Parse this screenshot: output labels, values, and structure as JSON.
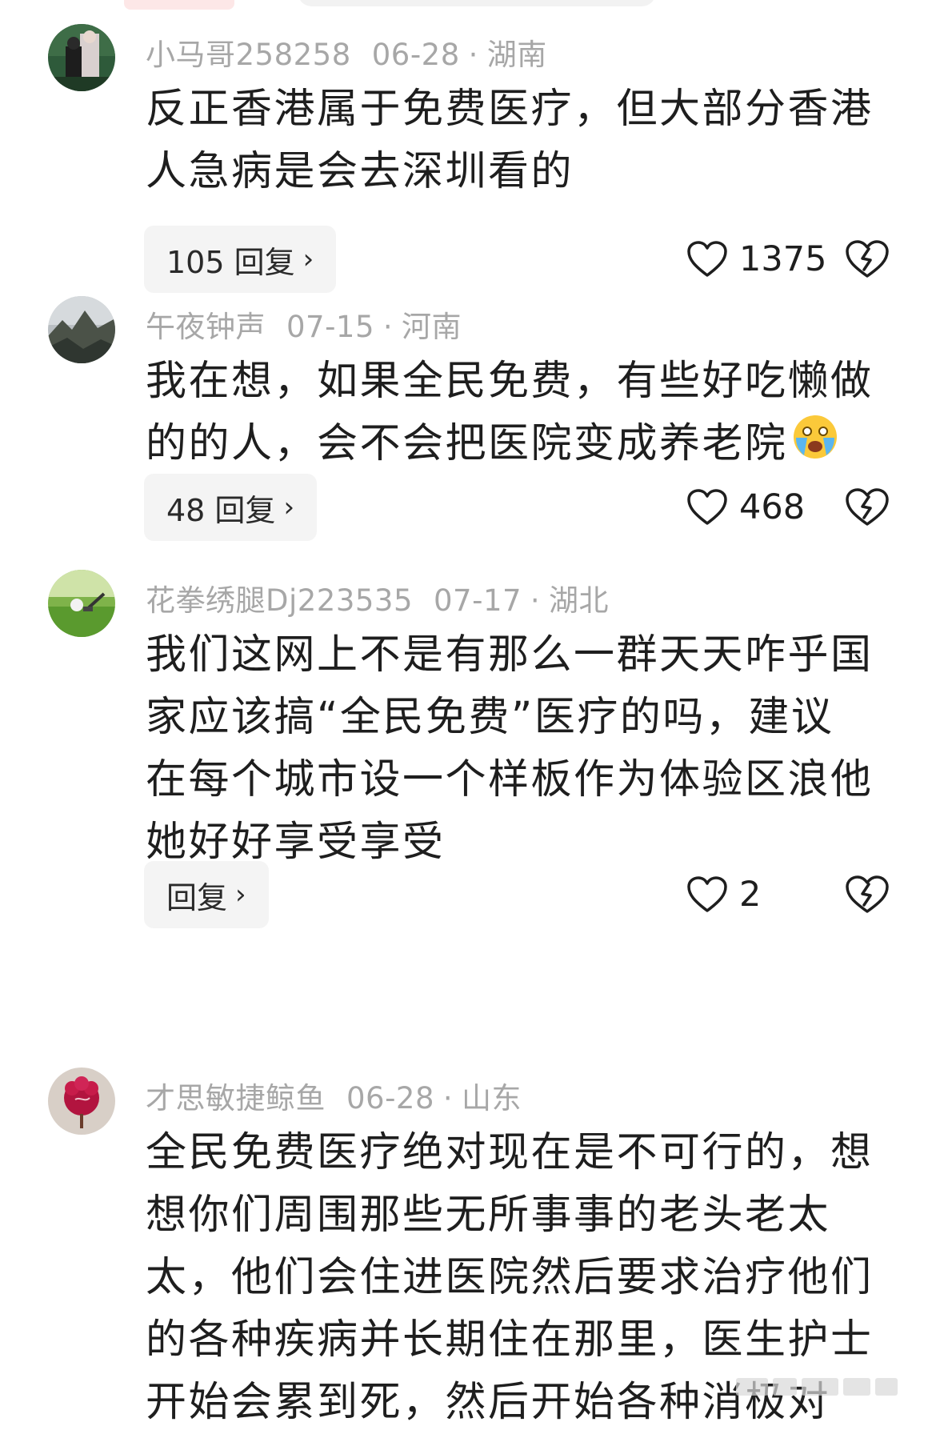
{
  "comments": [
    {
      "username": "小马哥258258",
      "date": "06-28",
      "separator": "·",
      "location": "湖南",
      "text_lines": [
        "反正香港属于免费医疗，但大部分香港",
        "人急病是会去深圳看的"
      ],
      "reply_label": "105 回复",
      "likes": "1375"
    },
    {
      "username": "午夜钟声",
      "date": "07-15",
      "separator": "·",
      "location": "河南",
      "text_lines": [
        "我在想，如果全民免费，有些好吃懒做",
        "的的人，会不会把医院变成养老院"
      ],
      "reply_label": "48 回复",
      "likes": "468"
    },
    {
      "username": "花拳绣腿Dj223535",
      "date": "07-17",
      "separator": "·",
      "location": "湖北",
      "text_lines": [
        "我们这网上不是有那么一群天天咋乎国",
        "家应该搞“全民免费”医疗的吗，建议",
        "在每个城市设一个样板作为体验区浪他",
        "她好好享受享受"
      ],
      "reply_label": "回复",
      "likes": "2"
    },
    {
      "username": "才思敏捷鲸鱼",
      "date": "06-28",
      "separator": "·",
      "location": "山东",
      "text_lines": [
        "全民免费医疗绝对现在是不可行的，想",
        "想你们周围那些无所事事的老头老太",
        "太，他们会住进医院然后要求治疗他们",
        "的各种疾病并长期住在那里，医生护士",
        "开始会累到死，然后开始各种消极对"
      ]
    }
  ],
  "chevron": "›",
  "icons": {
    "like": "heart-outline-icon",
    "dislike": "broken-heart-icon",
    "emoji": "crying-face-emoji"
  },
  "colors": {
    "meta": "#a7a7a7",
    "text": "#1e1e1e",
    "reply_bg": "#f4f4f4"
  }
}
